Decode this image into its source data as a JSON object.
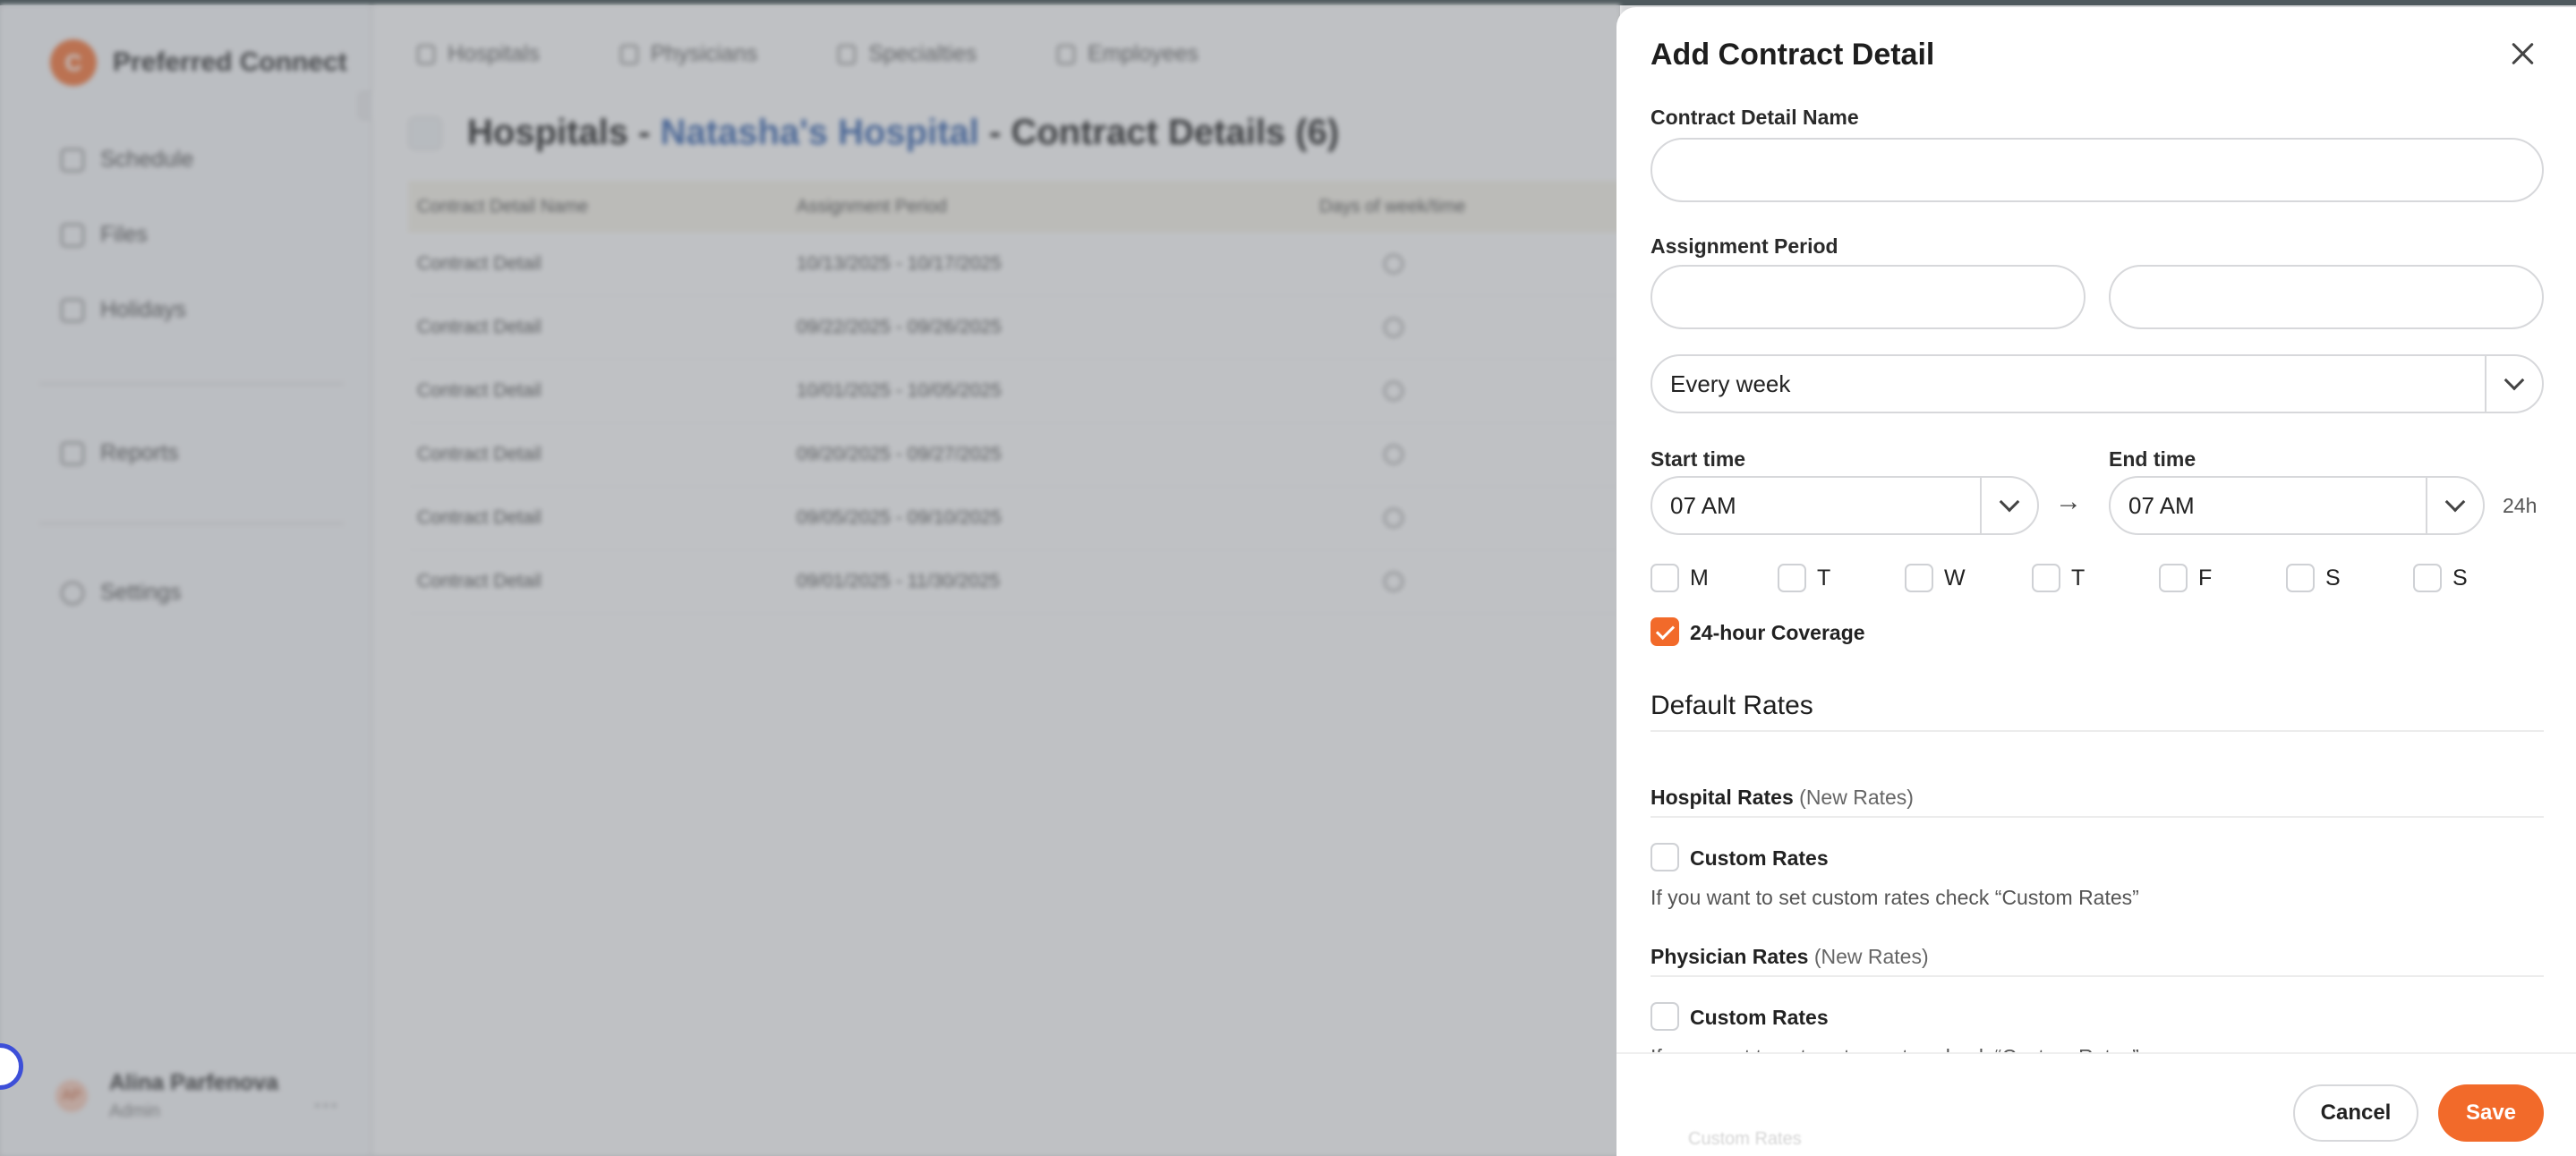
{
  "app": {
    "brand_letter": "C",
    "brand_name": "Preferred Connect",
    "nav": [
      {
        "label": "Schedule",
        "icon": "calendar-icon"
      },
      {
        "label": "Files",
        "icon": "folder-icon"
      },
      {
        "label": "Holidays",
        "icon": "calendar-icon"
      },
      {
        "label": "Reports",
        "icon": "document-icon"
      },
      {
        "label": "Settings",
        "icon": "gear-icon"
      }
    ],
    "user": {
      "initials": "AP",
      "name": "Alina Parfenova",
      "role": "Admin"
    },
    "top_tabs": [
      {
        "label": "Hospitals",
        "icon": "hospital-icon"
      },
      {
        "label": "Physicians",
        "icon": "people-icon"
      },
      {
        "label": "Specialties",
        "icon": "specialties-icon"
      },
      {
        "label": "Employees",
        "icon": "person-icon"
      }
    ],
    "page_title": {
      "part1": "Hospitals",
      "sep1": " - ",
      "link": "Natasha's Hospital",
      "sep2": " - ",
      "part2": "Contract Details (6)"
    },
    "table": {
      "headers": [
        "Contract Detail Name",
        "Assignment Period",
        "Days of week/time"
      ],
      "rows": [
        [
          "Contract Detail",
          "10/13/2025 - 10/17/2025"
        ],
        [
          "Contract Detail",
          "09/22/2025 - 09/26/2025"
        ],
        [
          "Contract Detail",
          "10/01/2025 - 10/05/2025"
        ],
        [
          "Contract Detail",
          "09/20/2025 - 09/27/2025"
        ],
        [
          "Contract Detail",
          "09/05/2025 - 09/10/2025"
        ],
        [
          "Contract Detail",
          "09/01/2025 - 11/30/2025"
        ]
      ]
    }
  },
  "drawer": {
    "title": "Add Contract Detail",
    "name_label": "Contract Detail Name",
    "name_value": "",
    "period_label": "Assignment Period",
    "period_start_value": "",
    "period_end_value": "",
    "recurrence_value": "Every week",
    "start_time_label": "Start time",
    "start_time_value": "07 AM",
    "end_time_label": "End time",
    "end_time_value": "07 AM",
    "arrow": "→",
    "format_suffix": "24h",
    "days": [
      {
        "label": "M",
        "checked": false
      },
      {
        "label": "T",
        "checked": false
      },
      {
        "label": "W",
        "checked": false
      },
      {
        "label": "T",
        "checked": false
      },
      {
        "label": "F",
        "checked": false
      },
      {
        "label": "S",
        "checked": false
      },
      {
        "label": "S",
        "checked": false
      }
    ],
    "coverage_label": "24-hour Coverage",
    "coverage_checked": true,
    "default_rates_title": "Default Rates",
    "hospital_rates": {
      "title": "Hospital Rates",
      "suffix": "(New Rates)",
      "custom_label": "Custom Rates",
      "custom_checked": false,
      "helper": "If you want to set custom rates check “Custom Rates”"
    },
    "physician_rates": {
      "title": "Physician Rates",
      "suffix": "(New Rates)",
      "custom_label": "Custom Rates",
      "custom_checked": false,
      "helper": "If you want to set custom rates check “Custom Rates”"
    },
    "ghost_label": "Custom Rates",
    "cancel_label": "Cancel",
    "save_label": "Save"
  },
  "colors": {
    "accent": "#f26a2a",
    "link": "#2b5aa8",
    "overlay": "#787c82"
  }
}
